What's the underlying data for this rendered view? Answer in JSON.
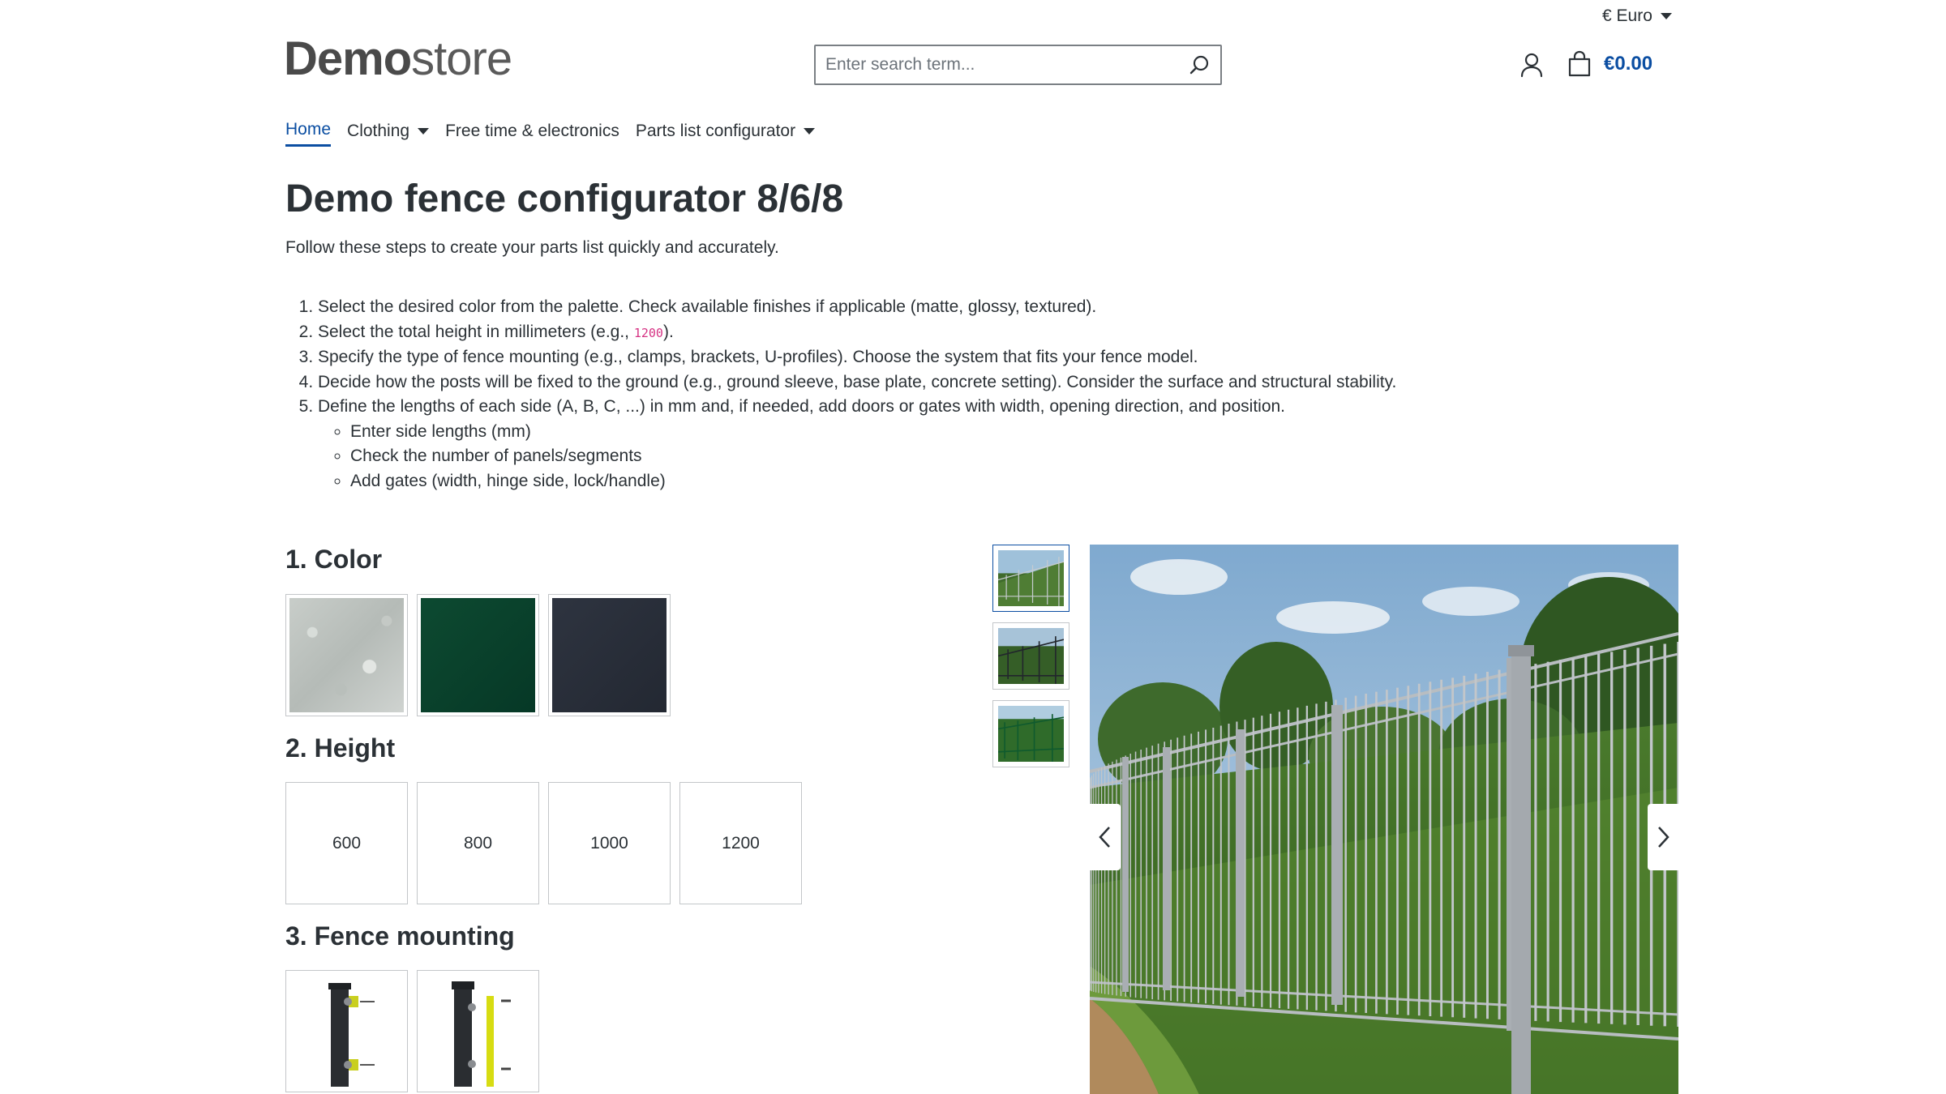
{
  "header": {
    "currency": "€ Euro",
    "logo_bold": "Demo",
    "logo_light": "store",
    "search_placeholder": "Enter search term...",
    "cart_total": "€0.00"
  },
  "nav": {
    "items": [
      {
        "label": "Home",
        "active": true,
        "dropdown": false
      },
      {
        "label": "Clothing",
        "active": false,
        "dropdown": true
      },
      {
        "label": "Free time & electronics",
        "active": false,
        "dropdown": false
      },
      {
        "label": "Parts list configurator",
        "active": false,
        "dropdown": true
      }
    ]
  },
  "page": {
    "title": "Demo fence configurator 8/6/8",
    "intro": "Follow these steps to create your parts list quickly and accurately.",
    "steps": [
      "Select the desired color from the palette. Check available finishes if applicable (matte, glossy, textured).",
      {
        "before": "Select the total height in millimeters (e.g., ",
        "code": "1200",
        "after": ")."
      },
      "Specify the type of fence mounting (e.g., clamps, brackets, U-profiles). Choose the system that fits your fence model.",
      "Decide how the posts will be fixed to the ground (e.g., ground sleeve, base plate, concrete setting). Consider the surface and structural stability.",
      "Define the lengths of each side (A, B, C, ...) in mm and, if needed, add doors or gates with width, opening direction, and position."
    ],
    "substeps": [
      "Enter side lengths (mm)",
      "Check the number of panels/segments",
      "Add gates (width, hinge side, lock/handle)"
    ]
  },
  "configurator": {
    "color": {
      "title": "1. Color",
      "swatches": [
        {
          "name": "galvanized",
          "color": "#c2c7c3"
        },
        {
          "name": "moss-green",
          "color": "#0b4530"
        },
        {
          "name": "anthracite",
          "color": "#2a2f3a"
        }
      ]
    },
    "height": {
      "title": "2. Height",
      "options": [
        "600",
        "800",
        "1000",
        "1200"
      ]
    },
    "mounting": {
      "title": "3. Fence mounting",
      "options": [
        "clamp-mounting",
        "u-profile-mounting"
      ]
    }
  },
  "gallery": {
    "thumbnails": [
      "fence-galvanized",
      "fence-anthracite",
      "fence-green"
    ],
    "active_index": 0,
    "prev_icon": "chevron-left-icon",
    "next_icon": "chevron-right-icon"
  },
  "colors": {
    "accent": "#0b4ea2",
    "text": "#2b3136",
    "code": "#d63384"
  }
}
